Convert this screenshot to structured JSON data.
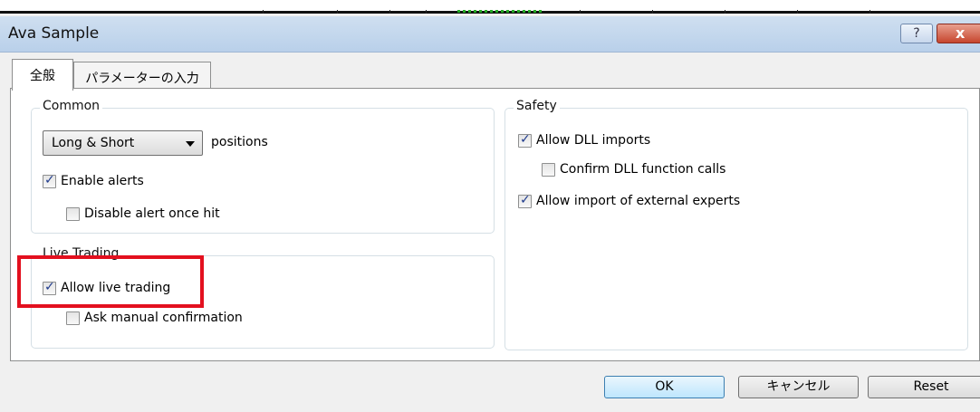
{
  "window": {
    "title": "Ava Sample",
    "help_label": "?",
    "close_label": "x"
  },
  "tabs": [
    {
      "label": "全般",
      "active": true
    },
    {
      "label": "パラメーターの入力",
      "active": false
    }
  ],
  "common": {
    "label": "Common",
    "positions_select": {
      "value": "Long & Short",
      "options_visible": [
        "Long & Short"
      ]
    },
    "positions_suffix": "positions",
    "enable_alerts": {
      "label": "Enable alerts",
      "checked": true
    },
    "disable_alert_once_hit": {
      "label": "Disable alert once hit",
      "checked": false
    }
  },
  "live_trading": {
    "label": "Live Trading",
    "allow_live_trading": {
      "label": "Allow live trading",
      "checked": true
    },
    "ask_manual_confirmation": {
      "label": "Ask manual confirmation",
      "checked": false
    }
  },
  "safety": {
    "label": "Safety",
    "allow_dll_imports": {
      "label": "Allow DLL imports",
      "checked": true
    },
    "confirm_dll_calls": {
      "label": "Confirm DLL function calls",
      "checked": false
    },
    "allow_external_experts": {
      "label": "Allow import of external experts",
      "checked": true
    }
  },
  "footer": {
    "ok_label": "OK",
    "cancel_label": "キャンセル",
    "reset_label": "Reset"
  },
  "colors": {
    "highlight": "#e3101f",
    "titlebar": "#c4d8ee",
    "checkmark": "#1e3a8c"
  }
}
